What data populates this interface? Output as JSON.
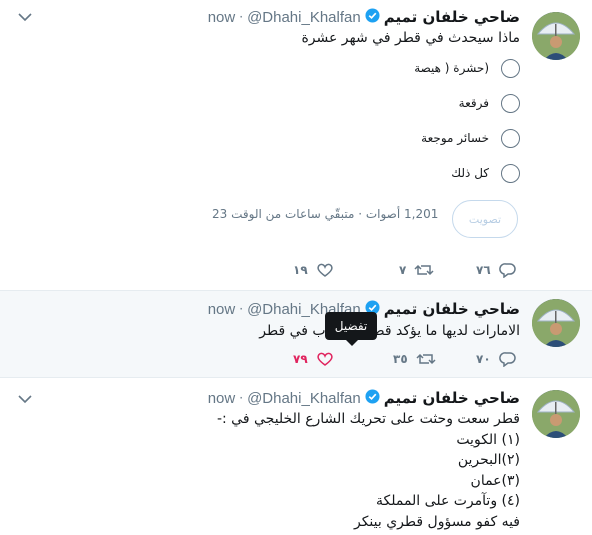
{
  "tweets": [
    {
      "name": "ضاحي خلفان تميم",
      "handle": "@Dhahi_Khalfan",
      "time": "now",
      "text": "ماذا سيحدث في قطر في شهر عشرة",
      "poll": {
        "options": [
          "(حشرة ( هيصة",
          "فرقعة",
          "خسائر موجعة",
          "كل ذلك"
        ],
        "vote_label": "تصويت",
        "votes": "1,201 أصوات",
        "remaining": "· متبقّي ساعات من الوقت 23"
      },
      "replies": "٧٦",
      "retweets": "٧",
      "likes": "١٩"
    },
    {
      "name": "ضاحي خلفان تميم",
      "handle": "@Dhahi_Khalfan",
      "time": "now",
      "text": "الامارات لديها ما يؤكد قضايا الارهاب في قطر",
      "replies": "٧٠",
      "retweets": "٣٥",
      "likes": "٧٩",
      "tooltip": "تفضيل"
    },
    {
      "name": "ضاحي خلفان تميم",
      "handle": "@Dhahi_Khalfan",
      "time": "now",
      "lines": [
        "قطر سعت وحثت على تحريك الشارع الخليجي  في :-",
        "(١) الكويت",
        "(٢)البحرين",
        "(٣)عمان",
        "(٤) وتآمرت على المملكة",
        "فيه كفو مسؤول قطري بينكر"
      ]
    }
  ],
  "colors": {
    "accent": "#1da1f2",
    "muted": "#657786",
    "like": "#e0245e",
    "verified": "#1da1f2"
  }
}
